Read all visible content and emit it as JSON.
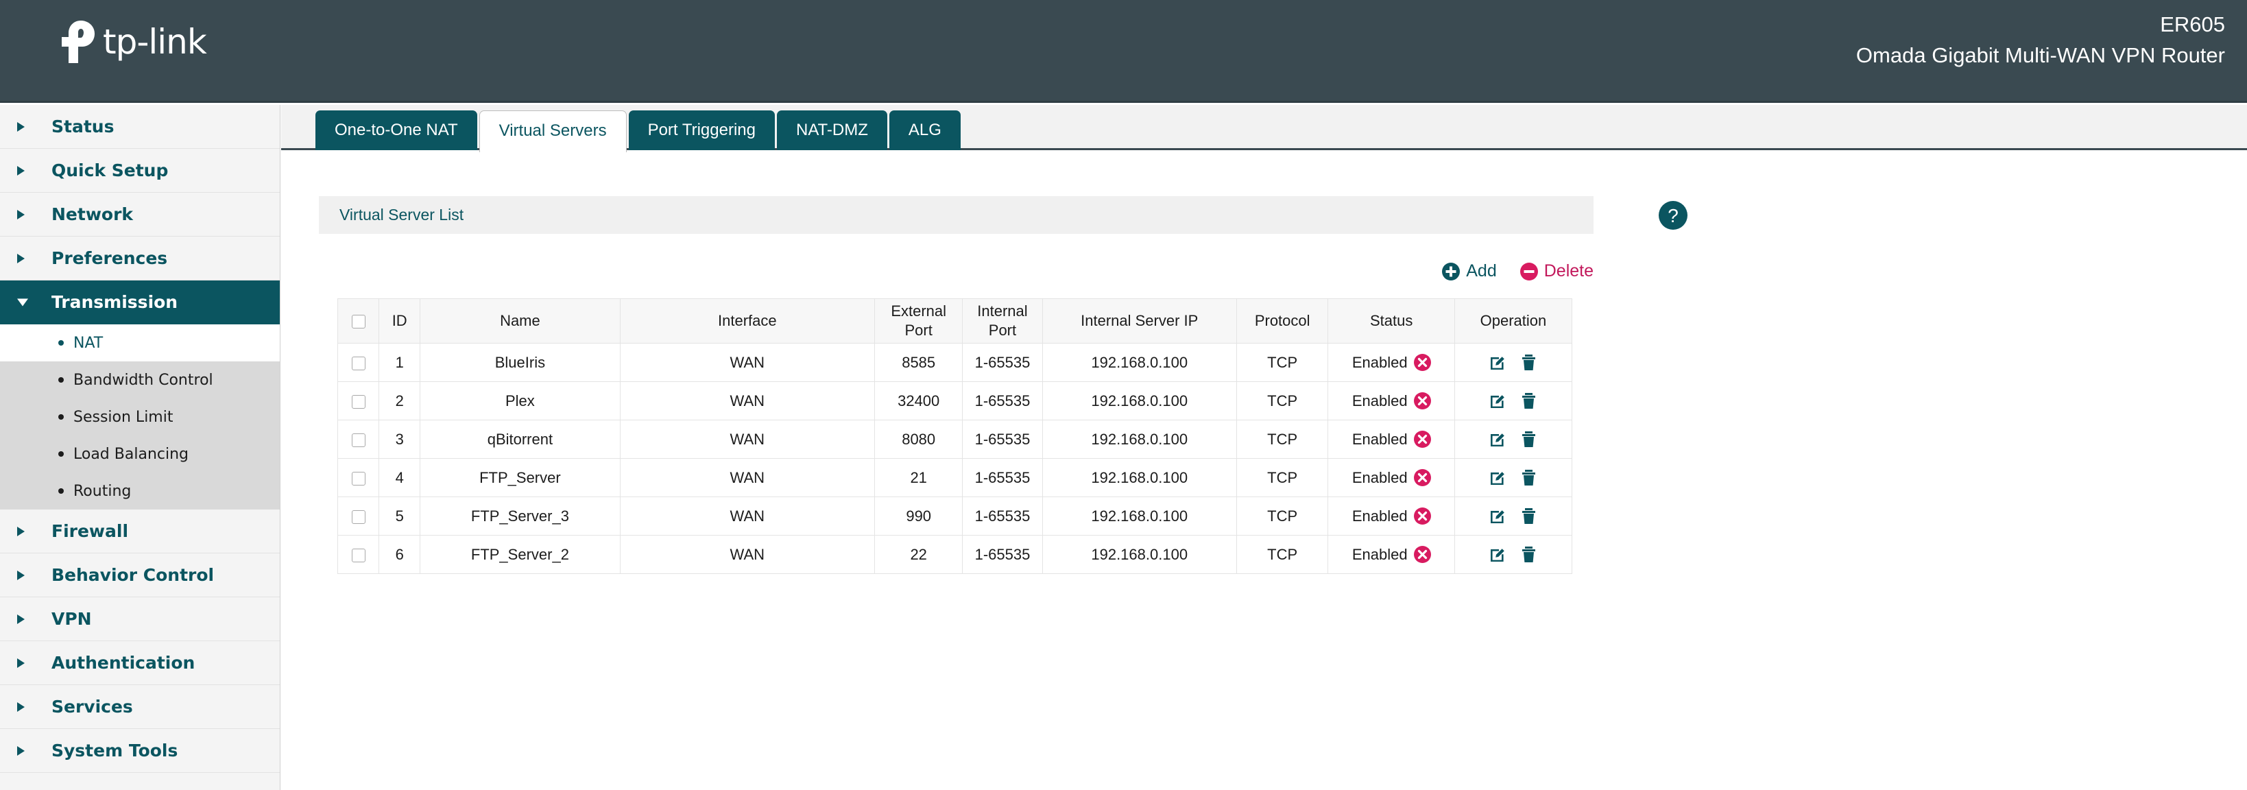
{
  "header": {
    "logo_text": "tp-link",
    "device_model": "ER605",
    "device_description": "Omada Gigabit Multi-WAN VPN Router"
  },
  "sidebar": {
    "groups": [
      {
        "label": "Status",
        "expanded": false,
        "active": false,
        "items": []
      },
      {
        "label": "Quick Setup",
        "expanded": false,
        "active": false,
        "items": []
      },
      {
        "label": "Network",
        "expanded": false,
        "active": false,
        "items": []
      },
      {
        "label": "Preferences",
        "expanded": false,
        "active": false,
        "items": []
      },
      {
        "label": "Transmission",
        "expanded": true,
        "active": true,
        "items": [
          {
            "label": "NAT",
            "active": true
          },
          {
            "label": "Bandwidth Control",
            "active": false
          },
          {
            "label": "Session Limit",
            "active": false
          },
          {
            "label": "Load Balancing",
            "active": false
          },
          {
            "label": "Routing",
            "active": false
          }
        ]
      },
      {
        "label": "Firewall",
        "expanded": false,
        "active": false,
        "items": []
      },
      {
        "label": "Behavior Control",
        "expanded": false,
        "active": false,
        "items": []
      },
      {
        "label": "VPN",
        "expanded": false,
        "active": false,
        "items": []
      },
      {
        "label": "Authentication",
        "expanded": false,
        "active": false,
        "items": []
      },
      {
        "label": "Services",
        "expanded": false,
        "active": false,
        "items": []
      },
      {
        "label": "System Tools",
        "expanded": false,
        "active": false,
        "items": []
      }
    ]
  },
  "tabs": [
    {
      "label": "One-to-One NAT",
      "active": false
    },
    {
      "label": "Virtual Servers",
      "active": true
    },
    {
      "label": "Port Triggering",
      "active": false
    },
    {
      "label": "NAT-DMZ",
      "active": false
    },
    {
      "label": "ALG",
      "active": false
    }
  ],
  "panel": {
    "title": "Virtual Server List",
    "help_icon": "help-circle-icon"
  },
  "toolbar": {
    "add_label": "Add",
    "add_icon": "plus-circle-icon",
    "delete_label": "Delete",
    "delete_icon": "minus-circle-icon"
  },
  "table": {
    "columns": [
      "",
      "ID",
      "Name",
      "Interface",
      "External\nPort",
      "Internal\nPort",
      "Internal Server IP",
      "Protocol",
      "Status",
      "Operation"
    ],
    "headers": {
      "id": "ID",
      "name": "Name",
      "interface": "Interface",
      "external_port_line1": "External",
      "external_port_line2": "Port",
      "internal_port_line1": "Internal",
      "internal_port_line2": "Port",
      "internal_server_ip": "Internal Server IP",
      "protocol": "Protocol",
      "status": "Status",
      "operation": "Operation"
    },
    "rows": [
      {
        "checked": false,
        "id": "1",
        "name": "BlueIris",
        "interface": "WAN",
        "external_port": "8585",
        "internal_port": "1-65535",
        "internal_server_ip": "192.168.0.100",
        "protocol": "TCP",
        "status": "Enabled",
        "status_icon": "disable-circle-x-icon",
        "edit_icon": "edit-icon",
        "delete_icon": "trash-icon"
      },
      {
        "checked": false,
        "id": "2",
        "name": "Plex",
        "interface": "WAN",
        "external_port": "32400",
        "internal_port": "1-65535",
        "internal_server_ip": "192.168.0.100",
        "protocol": "TCP",
        "status": "Enabled",
        "status_icon": "disable-circle-x-icon",
        "edit_icon": "edit-icon",
        "delete_icon": "trash-icon"
      },
      {
        "checked": false,
        "id": "3",
        "name": "qBitorrent",
        "interface": "WAN",
        "external_port": "8080",
        "internal_port": "1-65535",
        "internal_server_ip": "192.168.0.100",
        "protocol": "TCP",
        "status": "Enabled",
        "status_icon": "disable-circle-x-icon",
        "edit_icon": "edit-icon",
        "delete_icon": "trash-icon"
      },
      {
        "checked": false,
        "id": "4",
        "name": "FTP_Server",
        "interface": "WAN",
        "external_port": "21",
        "internal_port": "1-65535",
        "internal_server_ip": "192.168.0.100",
        "protocol": "TCP",
        "status": "Enabled",
        "status_icon": "disable-circle-x-icon",
        "edit_icon": "edit-icon",
        "delete_icon": "trash-icon"
      },
      {
        "checked": false,
        "id": "5",
        "name": "FTP_Server_3",
        "interface": "WAN",
        "external_port": "990",
        "internal_port": "1-65535",
        "internal_server_ip": "192.168.0.100",
        "protocol": "TCP",
        "status": "Enabled",
        "status_icon": "disable-circle-x-icon",
        "edit_icon": "edit-icon",
        "delete_icon": "trash-icon"
      },
      {
        "checked": false,
        "id": "6",
        "name": "FTP_Server_2",
        "interface": "WAN",
        "external_port": "22",
        "internal_port": "1-65535",
        "internal_server_ip": "192.168.0.100",
        "protocol": "TCP",
        "status": "Enabled",
        "status_icon": "disable-circle-x-icon",
        "edit_icon": "edit-icon",
        "delete_icon": "trash-icon"
      }
    ]
  },
  "colors": {
    "header_bg": "#3a4a51",
    "brand_teal": "#0b5560",
    "accent_crimson": "#c2185b",
    "sidebar_bg": "#f4f4f4",
    "subitem_bg": "#d9d9d9"
  }
}
